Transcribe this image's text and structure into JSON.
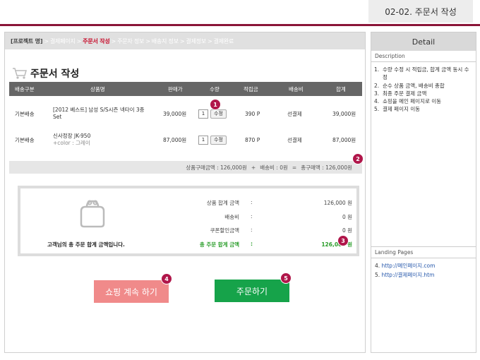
{
  "page_tab": "02-02. 주문서 작성",
  "breadcrumb": [
    {
      "label": "[프로젝트 명]",
      "type": "first"
    },
    {
      "label": "결제페이지",
      "type": "normal"
    },
    {
      "label": "주문서 작성",
      "type": "current"
    },
    {
      "label": "주문자 정보",
      "type": "normal"
    },
    {
      "label": "배송지 정보",
      "type": "normal"
    },
    {
      "label": "결제정보",
      "type": "normal"
    },
    {
      "label": "결제완료",
      "type": "normal"
    }
  ],
  "breadcrumb_sep": ">",
  "title": "주문서 작성",
  "table": {
    "headers": [
      "배송구분",
      "상품명",
      "판매가",
      "수량",
      "적립금",
      "배송비",
      "합계"
    ],
    "rows": [
      {
        "delivery": "기본배송",
        "name": "[2012 베스트] 남성 S/S시즌 넥타이 3종 Set",
        "option": "",
        "price": "39,000원",
        "qty": "1",
        "qty_btn": "수정",
        "points": "390 P",
        "shipping": "선결제",
        "total": "39,000원"
      },
      {
        "delivery": "기본배송",
        "name": "신사정장 JK-950",
        "option": "+color : 그레이",
        "price": "87,000원",
        "qty": "1",
        "qty_btn": "수정",
        "points": "870 P",
        "shipping": "선결제",
        "total": "87,000원"
      }
    ]
  },
  "summary_bar": {
    "subtotal": "상품구매금액 : 126,000원",
    "plus": "+",
    "shipping": "배송비 : 0원",
    "equals": "=",
    "total": "총구매액 : 126,000원"
  },
  "totals_box": {
    "caption": "고객님의 총 주문 합계 금액입니다.",
    "rows": [
      {
        "label": "상품 합계 금액",
        "colon": ":",
        "value": "126,000 원"
      },
      {
        "label": "배송비",
        "colon": ":",
        "value": "0 원"
      },
      {
        "label": "쿠폰할인금액",
        "colon": ":",
        "value": "0 원"
      },
      {
        "label": "총 주문 합계 금액",
        "colon": ":",
        "value": "126,000 원"
      }
    ]
  },
  "buttons": {
    "continue_shopping": "쇼핑 계속 하기",
    "order": "주문하기"
  },
  "badges": [
    "1",
    "2",
    "3",
    "4",
    "5"
  ],
  "side": {
    "detail_title": "Detail",
    "description_label": "Description",
    "description": [
      {
        "num": "1.",
        "text": "수량 수정 시 적립금, 합계 금액 동시 수정"
      },
      {
        "num": "2.",
        "text": "순수 상품 금액, 배송비 총합"
      },
      {
        "num": "3.",
        "text": "최종 주문 결제 금액"
      },
      {
        "num": "4.",
        "text": "쇼핑을 메인 페이지로 이동"
      },
      {
        "num": "5.",
        "text": "결제 페이지 이동"
      }
    ],
    "landing_label": "Landing Pages",
    "links": [
      {
        "num": "4.",
        "url": "http://메인페이지.com"
      },
      {
        "num": "5.",
        "url": "http://결제페이지.htm"
      }
    ]
  },
  "colors": {
    "accent": "#8a1538",
    "current_crumb": "#c8102e",
    "badge": "#b0164a",
    "order_button": "#16a34a",
    "shop_button": "#f08a8a",
    "total_green": "#2a9d2a"
  }
}
